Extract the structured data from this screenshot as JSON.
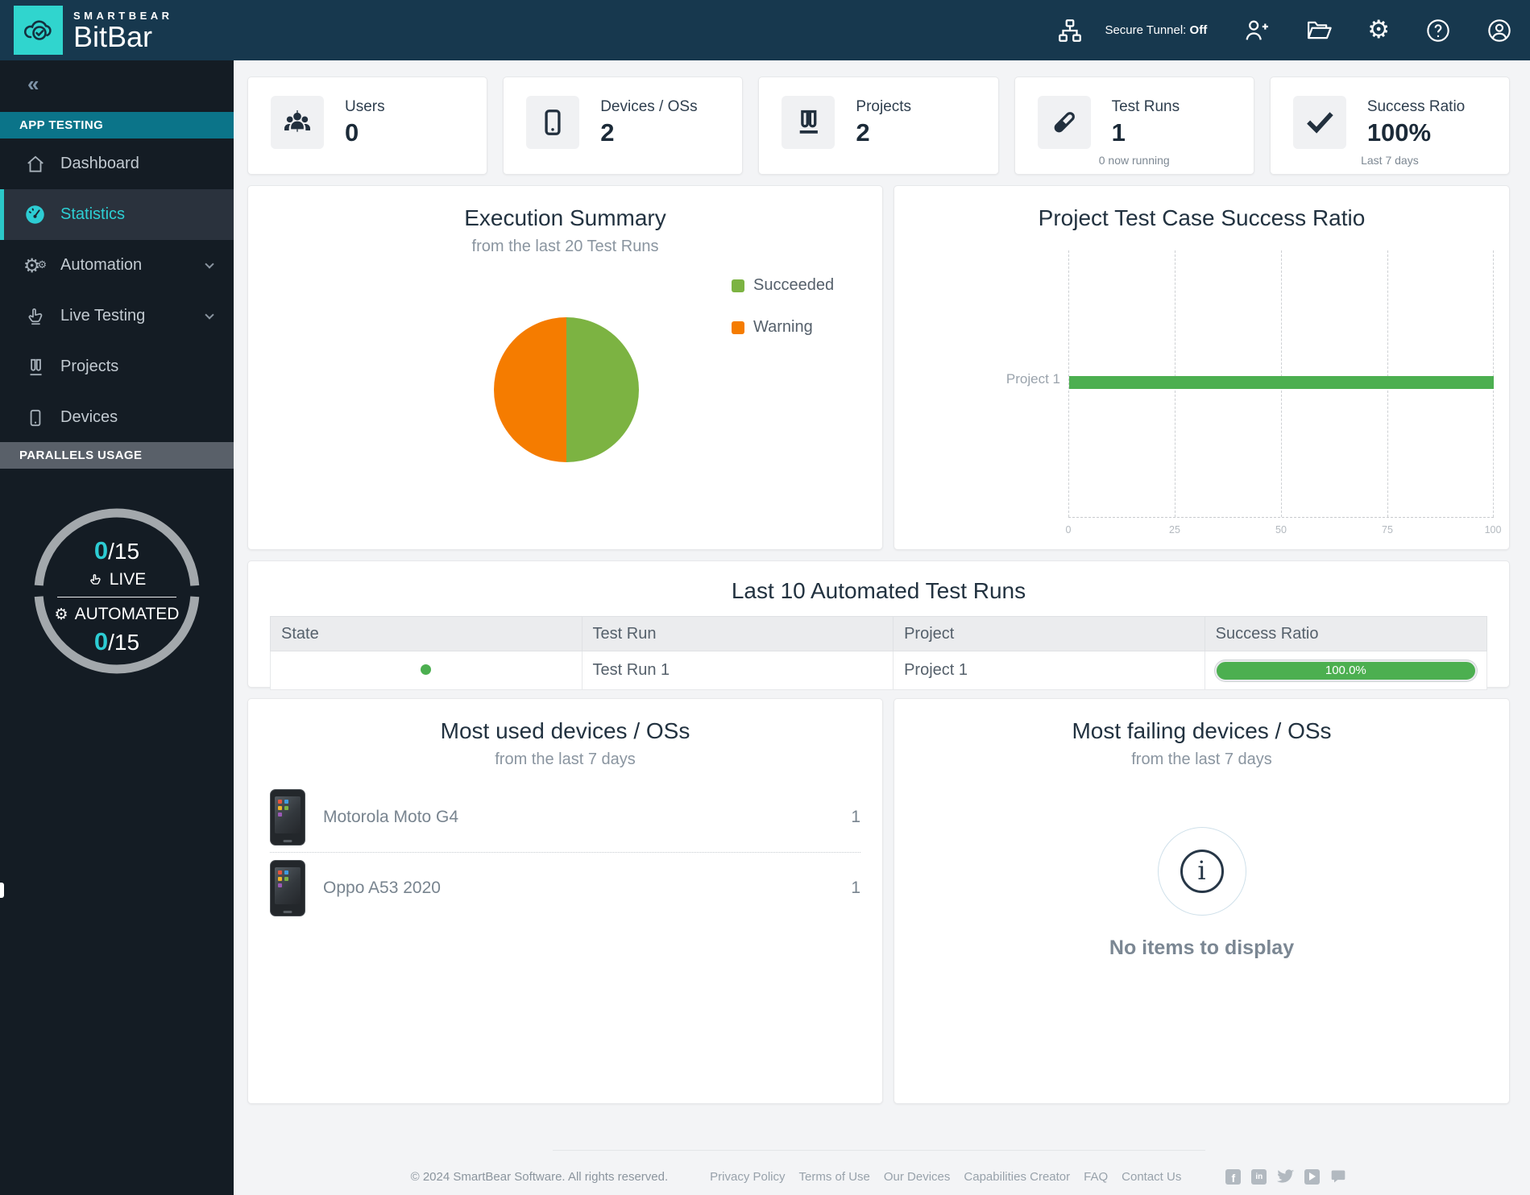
{
  "brand": {
    "company": "SMARTBEAR",
    "product": "BitBar"
  },
  "navbar": {
    "secure_tunnel_label": "Secure Tunnel:",
    "secure_tunnel_value": "Off"
  },
  "sidebar": {
    "collapse_glyph": "«",
    "section_app_testing": "APP TESTING",
    "items": [
      {
        "label": "Dashboard"
      },
      {
        "label": "Statistics"
      },
      {
        "label": "Automation"
      },
      {
        "label": "Live Testing"
      },
      {
        "label": "Projects"
      },
      {
        "label": "Devices"
      }
    ],
    "section_parallels": "PARALLELS USAGE",
    "gauge": {
      "live_value": "0",
      "live_total": "/15",
      "live_label": "LIVE",
      "automated_value": "0",
      "automated_total": "/15",
      "automated_label": "AUTOMATED"
    }
  },
  "stats": [
    {
      "label": "Users",
      "value": "0",
      "sub": ""
    },
    {
      "label": "Devices / OSs",
      "value": "2",
      "sub": ""
    },
    {
      "label": "Projects",
      "value": "2",
      "sub": ""
    },
    {
      "label": "Test Runs",
      "value": "1",
      "sub": "0 now running"
    },
    {
      "label": "Success Ratio",
      "value": "100%",
      "sub": "Last 7 days"
    }
  ],
  "execution_summary": {
    "title": "Execution Summary",
    "subtitle": "from the last 20 Test Runs",
    "legend": [
      {
        "label": "Succeeded",
        "color": "#7cb342"
      },
      {
        "label": "Warning",
        "color": "#f57c00"
      }
    ]
  },
  "project_ratio": {
    "title": "Project Test Case Success Ratio",
    "row_label": "Project 1",
    "ticks": [
      "0",
      "25",
      "50",
      "75",
      "100"
    ]
  },
  "chart_data": [
    {
      "type": "pie",
      "title": "Execution Summary",
      "subtitle": "from the last 20 Test Runs",
      "labels": [
        "Succeeded",
        "Warning"
      ],
      "values": [
        50,
        50
      ],
      "colors": [
        "#7cb342",
        "#f57c00"
      ],
      "legend_position": "right"
    },
    {
      "type": "bar",
      "orientation": "horizontal",
      "title": "Project Test Case Success Ratio",
      "categories": [
        "Project 1"
      ],
      "values": [
        100
      ],
      "xlim": [
        0,
        100
      ],
      "xticks": [
        0,
        25,
        50,
        75,
        100
      ],
      "bar_color": "#4caf50",
      "grid": "vertical-dashed"
    }
  ],
  "table": {
    "title": "Last 10 Automated Test Runs",
    "headers": [
      "State",
      "Test Run",
      "Project",
      "Success Ratio"
    ],
    "rows": [
      {
        "state": "succeeded",
        "test_run": "Test Run 1",
        "project": "Project 1",
        "success_ratio": "100.0%"
      }
    ]
  },
  "most_used": {
    "title": "Most used devices / OSs",
    "subtitle": "from the last 7 days",
    "devices": [
      {
        "name": "Motorola Moto G4",
        "count": "1"
      },
      {
        "name": "Oppo A53 2020",
        "count": "1"
      }
    ]
  },
  "most_failing": {
    "title": "Most failing devices / OSs",
    "subtitle": "from the last 7 days",
    "empty_text": "No items to display"
  },
  "footer": {
    "copyright": "© 2024 SmartBear Software. All rights reserved.",
    "links": [
      "Privacy Policy",
      "Terms of Use",
      "Our Devices",
      "Capabilities Creator",
      "FAQ",
      "Contact Us"
    ],
    "socials": [
      {
        "name": "facebook",
        "glyph": "f"
      },
      {
        "name": "linkedin",
        "glyph": "in"
      },
      {
        "name": "twitter",
        "glyph": ""
      },
      {
        "name": "youtube",
        "glyph": ""
      },
      {
        "name": "chat",
        "glyph": ""
      }
    ]
  },
  "colors": {
    "accent_teal": "#2dccd3",
    "navbar_bg": "#17384e",
    "sidebar_bg": "#141c24",
    "section_teal": "#0b7489",
    "success_green": "#4caf50",
    "pie_green": "#7cb342",
    "warning_orange": "#f57c00"
  }
}
